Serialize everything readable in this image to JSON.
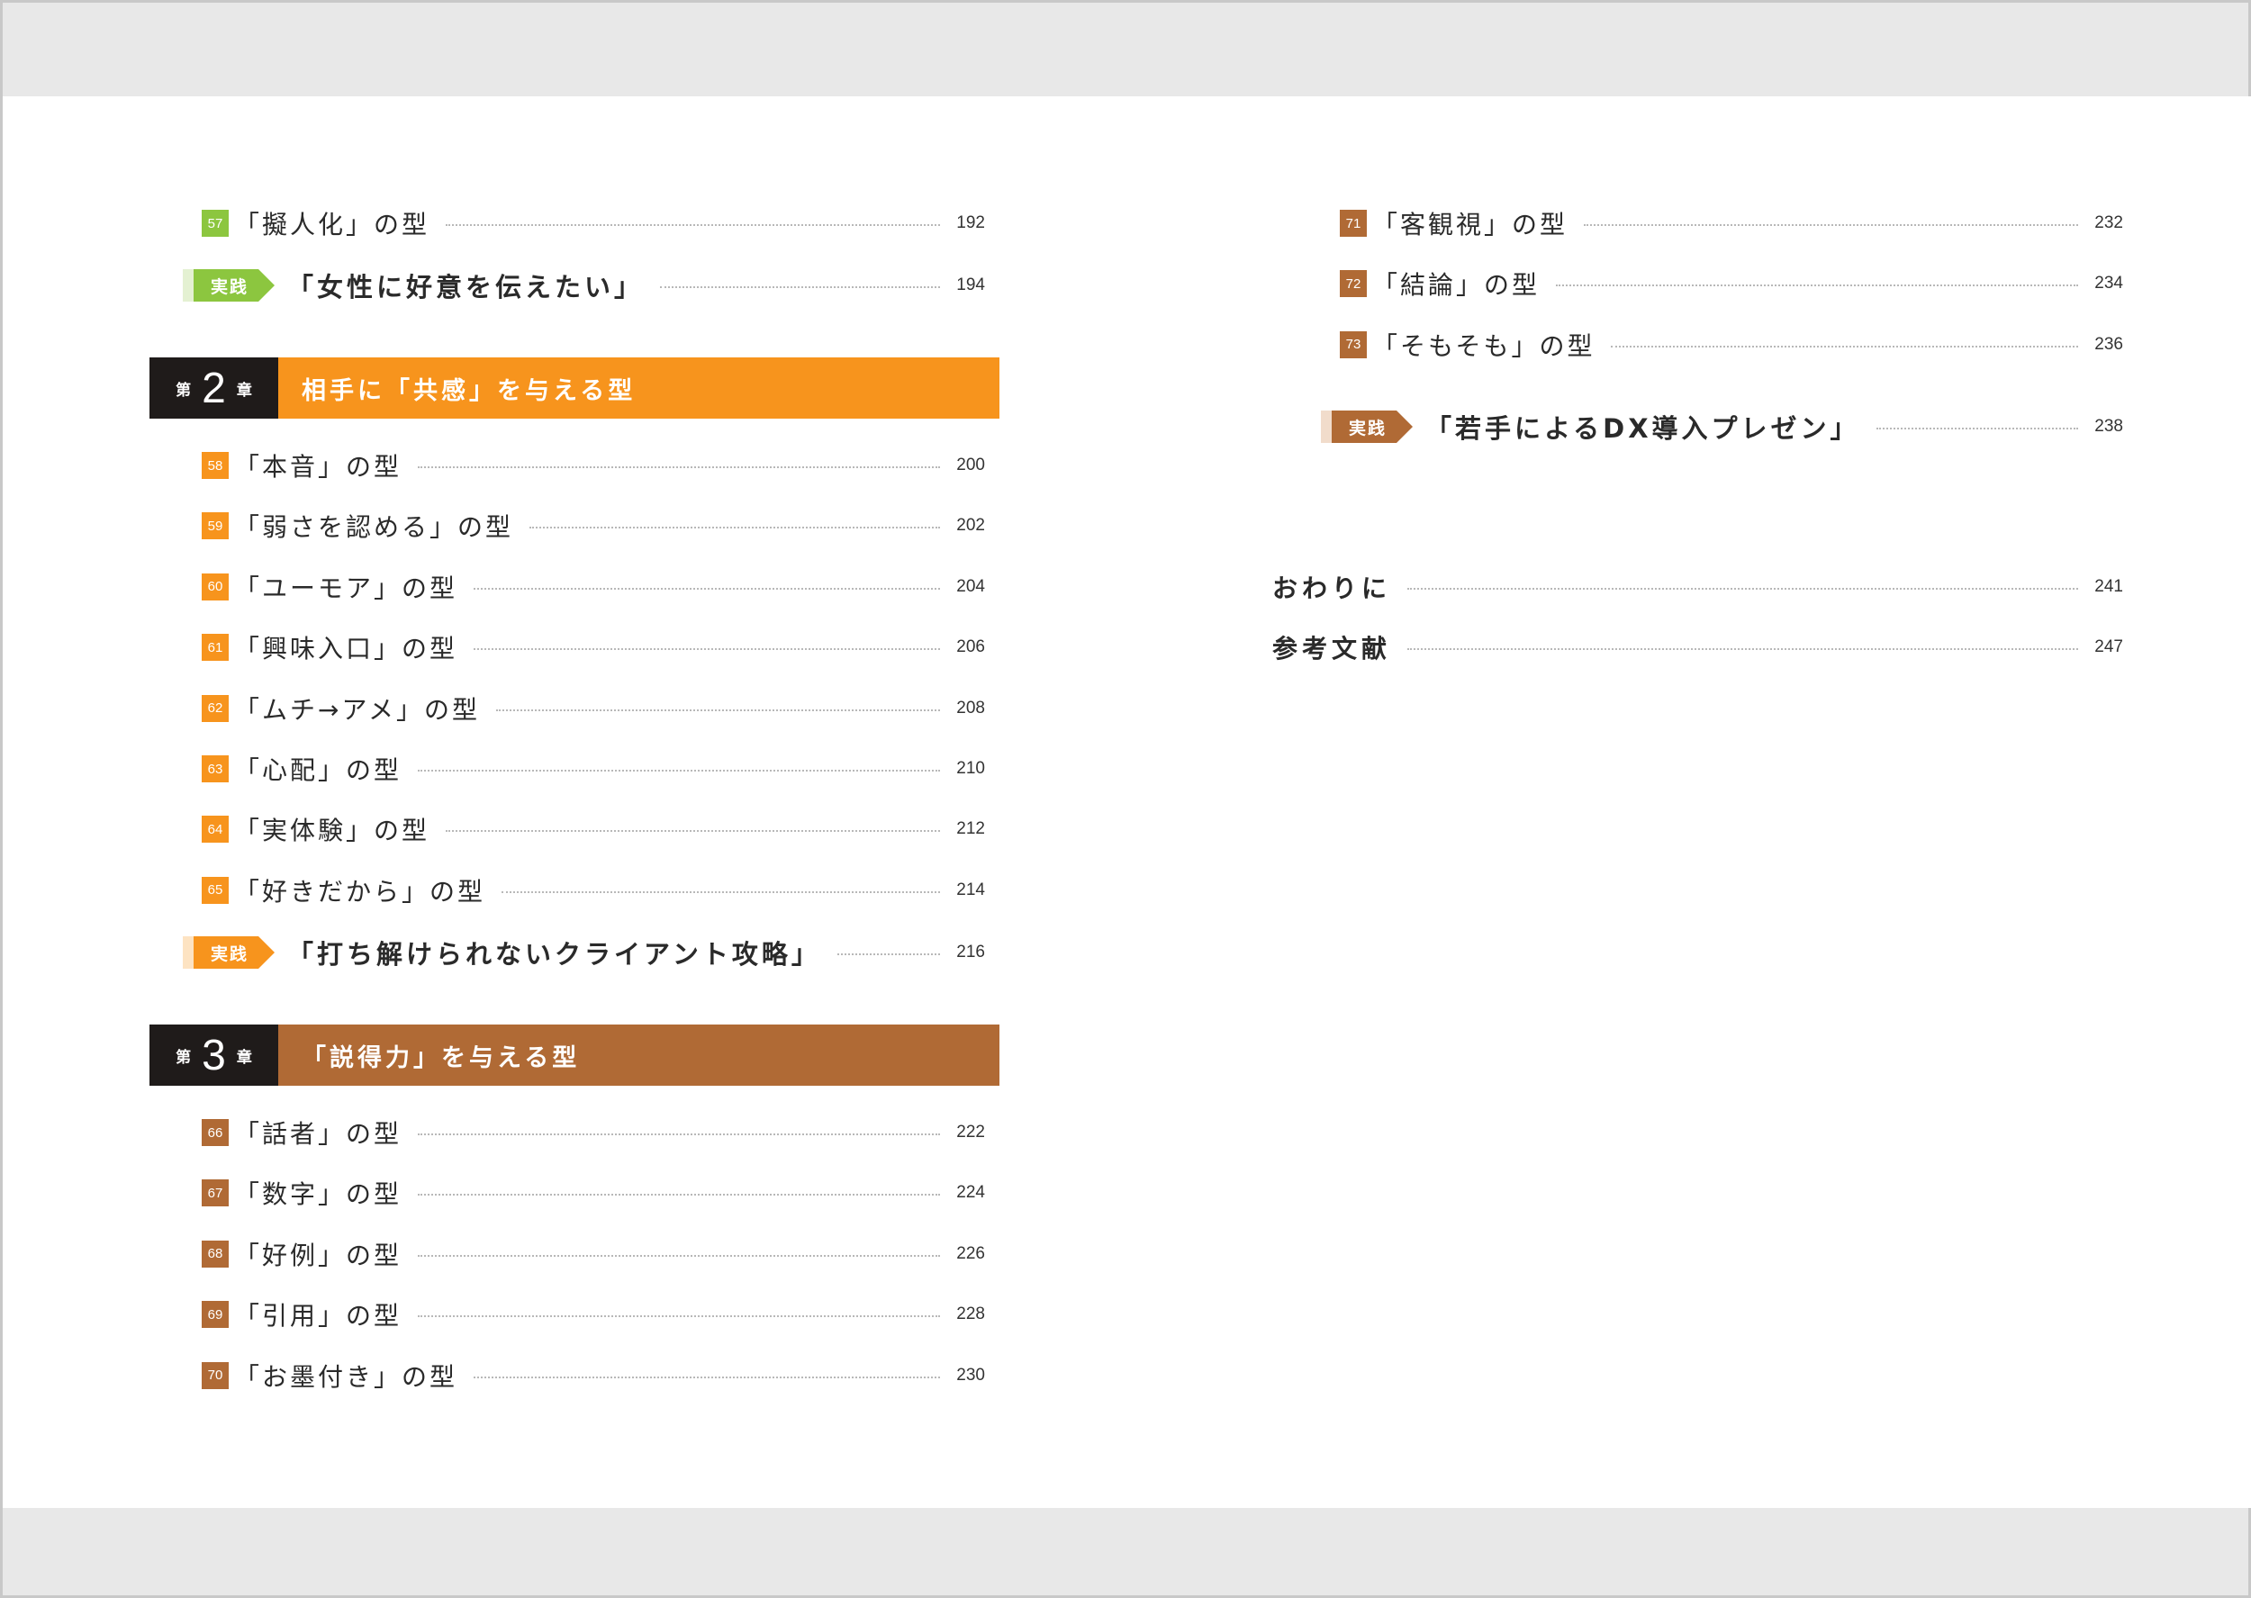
{
  "colors": {
    "green": "#8cc63f",
    "orange": "#f7941d",
    "brown": "#b06a35",
    "dark": "#1f1b1a"
  },
  "left": {
    "top_entries": [
      {
        "num": "57",
        "title": "「擬人化」の型",
        "page": "192"
      }
    ],
    "practice1": {
      "tag": "実践",
      "title": "「女性に好意を伝えたい」",
      "page": "194"
    },
    "chapter2": {
      "prefix": "第",
      "num": "2",
      "suffix": "章",
      "title": "相手に「共感」を与える型"
    },
    "ch2_entries": [
      {
        "num": "58",
        "title": "「本音」の型",
        "page": "200"
      },
      {
        "num": "59",
        "title": "「弱さを認める」の型",
        "page": "202"
      },
      {
        "num": "60",
        "title": "「ユーモア」の型",
        "page": "204"
      },
      {
        "num": "61",
        "title": "「興味入口」の型",
        "page": "206"
      },
      {
        "num": "62",
        "title": "「ムチ→アメ」の型",
        "page": "208"
      },
      {
        "num": "63",
        "title": "「心配」の型",
        "page": "210"
      },
      {
        "num": "64",
        "title": "「実体験」の型",
        "page": "212"
      },
      {
        "num": "65",
        "title": "「好きだから」の型",
        "page": "214"
      }
    ],
    "practice2": {
      "tag": "実践",
      "title": "「打ち解けられないクライアント攻略」",
      "page": "216"
    },
    "chapter3": {
      "prefix": "第",
      "num": "3",
      "suffix": "章",
      "title": "「説得力」を与える型"
    },
    "ch3_entries": [
      {
        "num": "66",
        "title": "「話者」の型",
        "page": "222"
      },
      {
        "num": "67",
        "title": "「数字」の型",
        "page": "224"
      },
      {
        "num": "68",
        "title": "「好例」の型",
        "page": "226"
      },
      {
        "num": "69",
        "title": "「引用」の型",
        "page": "228"
      },
      {
        "num": "70",
        "title": "「お墨付き」の型",
        "page": "230"
      }
    ]
  },
  "right": {
    "entries": [
      {
        "num": "71",
        "title": "「客観視」の型",
        "page": "232"
      },
      {
        "num": "72",
        "title": "「結論」の型",
        "page": "234"
      },
      {
        "num": "73",
        "title": "「そもそも」の型",
        "page": "236"
      }
    ],
    "practice3": {
      "tag": "実践",
      "title": "「若手によるDX導入プレゼン」",
      "page": "238"
    },
    "misc": [
      {
        "title": "おわりに",
        "page": "241"
      },
      {
        "title": "参考文献",
        "page": "247"
      }
    ]
  }
}
